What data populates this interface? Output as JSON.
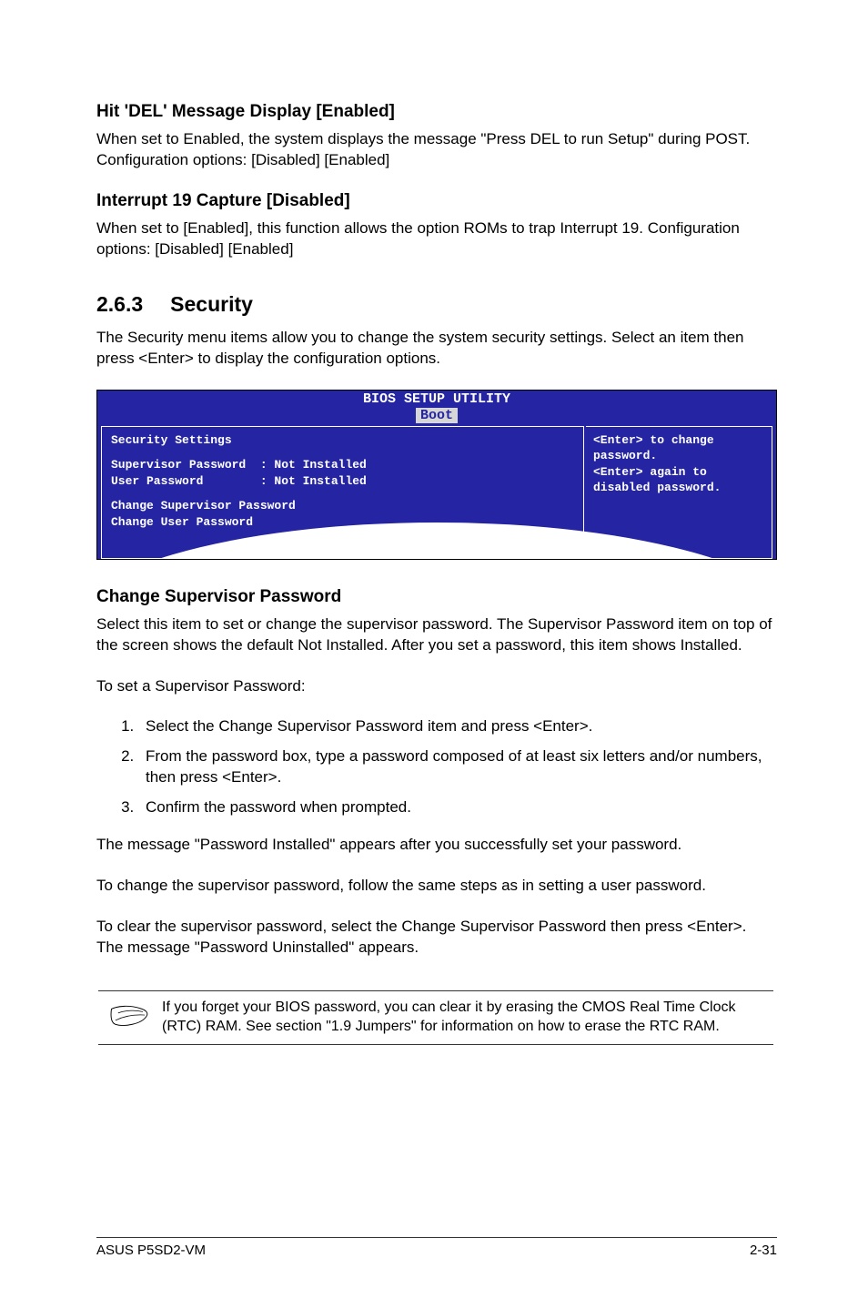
{
  "sections": {
    "s1": {
      "title": "Hit 'DEL' Message Display [Enabled]",
      "p1": "When set to Enabled, the system displays the message \"Press DEL to run Setup\" during POST.",
      "p2": "Configuration options: [Disabled] [Enabled]"
    },
    "s2": {
      "title": "Interrupt 19 Capture [Disabled]",
      "p1": "When set to [Enabled], this function allows the option ROMs to trap Interrupt 19. Configuration options: [Disabled] [Enabled]"
    },
    "sec": {
      "num": "2.6.3",
      "title": "Security",
      "intro": "The Security menu items allow you to change the system security settings. Select an item then press <Enter> to display the configuration options."
    },
    "bios": {
      "title": "BIOS SETUP UTILITY",
      "tab": "Boot",
      "left_heading": "Security Settings",
      "left_row1": "Supervisor Password  : Not Installed",
      "left_row2": "User Password        : Not Installed",
      "left_row3": "Change Supervisor Password",
      "left_row4": "Change User Password",
      "right_l1": "<Enter> to change",
      "right_l2": "password.",
      "right_l3": "<Enter> again to",
      "right_l4": "disabled password."
    },
    "csp": {
      "title": "Change Supervisor Password",
      "p1": "Select this item to set or change the supervisor password. The Supervisor Password item on top of the screen shows the default Not Installed. After you set a password, this item shows Installed.",
      "p2": "To set a Supervisor Password:",
      "steps": {
        "1": "Select the Change Supervisor Password item and press <Enter>.",
        "2": "From the password box, type a password composed of at least six letters and/or numbers, then press <Enter>.",
        "3": "Confirm the password when prompted."
      },
      "p3": "The message \"Password Installed\" appears after you successfully set your password.",
      "p4": "To change the supervisor password, follow the same steps as in setting a user password.",
      "p5": "To clear the supervisor password, select the Change Supervisor Password then press <Enter>. The message \"Password Uninstalled\" appears."
    },
    "note": "If you forget your BIOS password, you can clear it by erasing the CMOS Real Time Clock (RTC) RAM. See section \"1.9 Jumpers\" for information on how to erase the RTC RAM."
  },
  "footer": {
    "left": "ASUS P5SD2-VM",
    "right": "2-31"
  }
}
